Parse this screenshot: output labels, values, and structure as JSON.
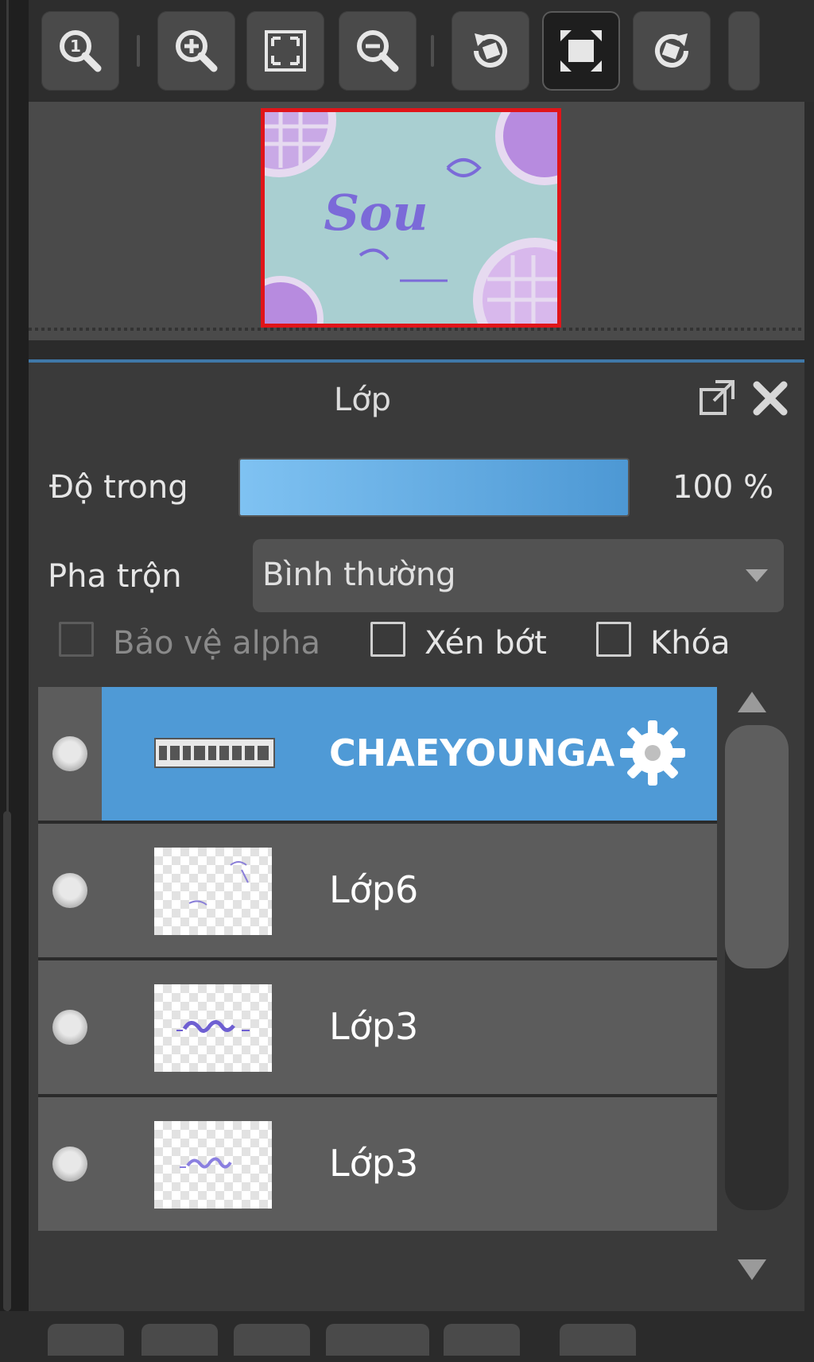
{
  "toolbar": {
    "buttons": [
      {
        "id": "actual-size",
        "icon": "zoom-actual-size-icon"
      },
      {
        "id": "zoom-in",
        "icon": "zoom-in-icon"
      },
      {
        "id": "fit-screen",
        "icon": "fit-screen-icon"
      },
      {
        "id": "zoom-out",
        "icon": "zoom-out-icon"
      },
      {
        "id": "rotate-left",
        "icon": "rotate-left-icon"
      },
      {
        "id": "reset-rotation",
        "icon": "reset-rotation-icon",
        "active": true
      },
      {
        "id": "rotate-right",
        "icon": "rotate-right-icon"
      }
    ]
  },
  "navigator": {
    "canvas_bg": "#a9cfd1",
    "frame_color": "#e0151a"
  },
  "layer_panel": {
    "title": "Lớp",
    "opacity": {
      "label": "Độ trong",
      "value": 100,
      "value_text": "100 %"
    },
    "blend": {
      "label": "Pha trộn",
      "selected": "Bình thường"
    },
    "checkboxes": [
      {
        "label": "Bảo vệ alpha",
        "checked": false,
        "disabled": true
      },
      {
        "label": "Xén bớt",
        "checked": false,
        "disabled": false
      },
      {
        "label": "Khóa",
        "checked": false,
        "disabled": false
      }
    ],
    "layers": [
      {
        "name": "CHAEYOUNGA",
        "selected": true,
        "type": "text",
        "visible": true
      },
      {
        "name": "Lớp6",
        "selected": false,
        "type": "raster",
        "visible": true
      },
      {
        "name": "Lớp3",
        "selected": false,
        "type": "raster",
        "visible": true
      },
      {
        "name": "Lớp3",
        "selected": false,
        "type": "raster",
        "visible": true
      }
    ],
    "accent_color": "#4f9ad6"
  }
}
